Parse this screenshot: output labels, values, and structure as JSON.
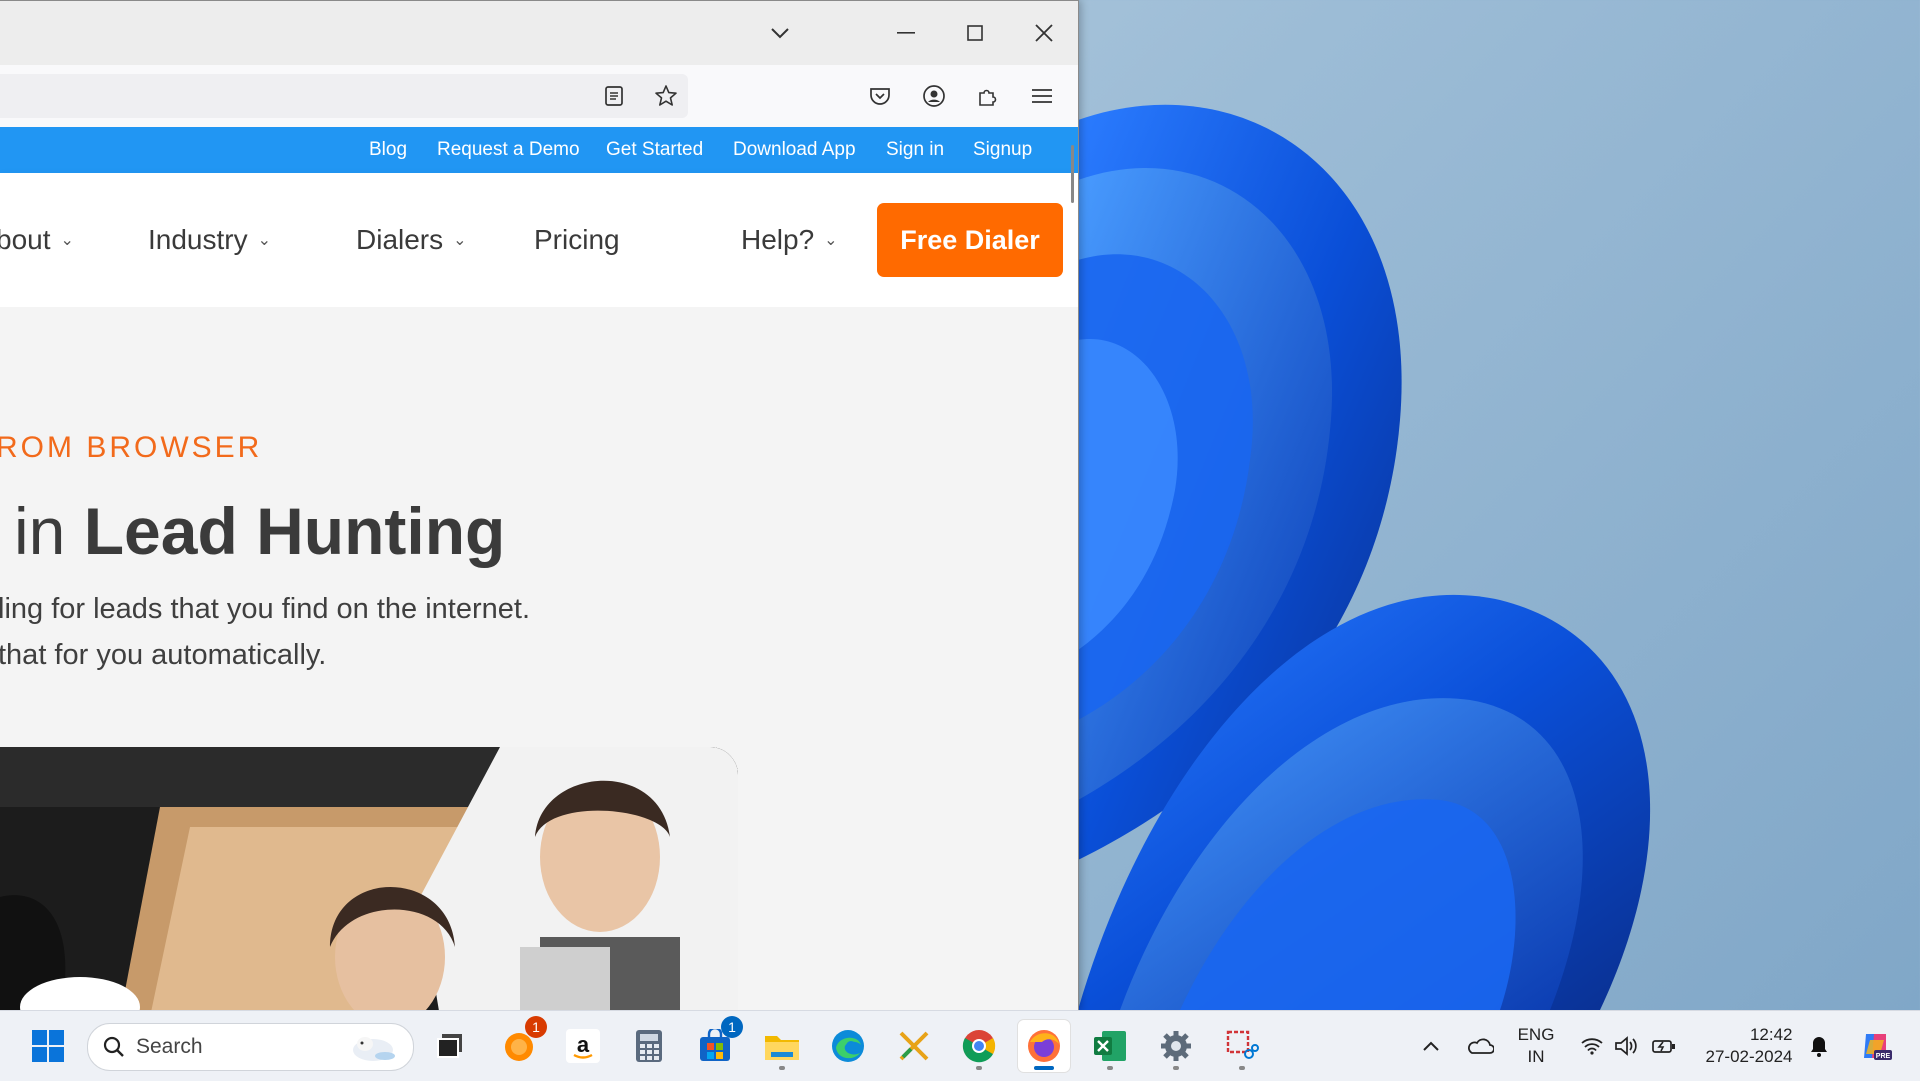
{
  "topnav": {
    "links": [
      "Blog",
      "Request a Demo",
      "Get Started",
      "Download App",
      "Sign in",
      "Signup"
    ]
  },
  "mainnav": {
    "items": [
      "bout",
      "Industry",
      "Dialers",
      "Pricing",
      "Help?"
    ],
    "cta": "Free Dialer"
  },
  "hero": {
    "eyebrow": "ROM BROWSER",
    "headline_pre": " in ",
    "headline_bold": "Lead Hunting",
    "sub_line1": "ling for leads that you find on the internet.",
    "sub_line2": "that for you automatically."
  },
  "taskbar": {
    "search_placeholder": "Search",
    "badges": {
      "firefox_preview": "1",
      "store": "1"
    },
    "language_line1": "ENG",
    "language_line2": "IN",
    "time": "12:42",
    "date": "27-02-2024"
  },
  "colors": {
    "topnav_bg": "#2196f3",
    "cta_bg": "#ff6a00",
    "eyebrow": "#f26a1b"
  },
  "icons": [
    "chevron-down-icon",
    "minimize-icon",
    "maximize-icon",
    "close-icon",
    "reader-view-icon",
    "bookmark-star-icon",
    "pocket-icon",
    "account-icon",
    "extensions-icon",
    "menu-icon",
    "windows-start-icon",
    "search-icon",
    "task-view-icon",
    "amazon-icon",
    "calculator-icon",
    "store-icon",
    "file-explorer-icon",
    "edge-icon",
    "chrome-icon",
    "firefox-icon",
    "excel-icon",
    "settings-icon",
    "snipping-tool-icon",
    "chevron-up-icon",
    "onedrive-icon",
    "wifi-icon",
    "volume-icon",
    "battery-icon",
    "notification-bell-icon",
    "copilot-icon"
  ]
}
